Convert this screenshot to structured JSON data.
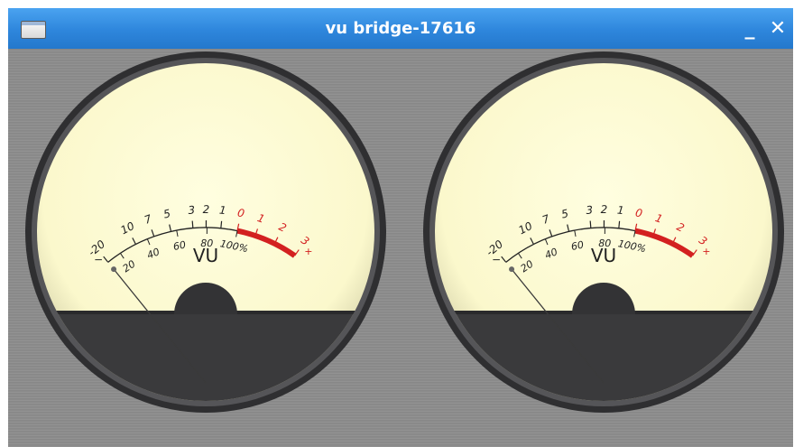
{
  "window": {
    "title": "vu bridge-17616",
    "minimize_label": "_",
    "close_label": "✕"
  },
  "meters": [
    {
      "label": "VU",
      "reading_db": -20,
      "db_scale": [
        {
          "label": "-20",
          "red": false
        },
        {
          "label": "10",
          "red": false
        },
        {
          "label": "7",
          "red": false
        },
        {
          "label": "5",
          "red": false
        },
        {
          "label": "3",
          "red": false
        },
        {
          "label": "2",
          "red": false
        },
        {
          "label": "1",
          "red": false
        },
        {
          "label": "0",
          "red": true
        },
        {
          "label": "1",
          "red": true
        },
        {
          "label": "2",
          "red": true
        },
        {
          "label": "3",
          "red": true
        }
      ],
      "percent_scale": [
        "20",
        "40",
        "60",
        "80",
        "100%"
      ],
      "plus_mark": "+",
      "minus_mark": "−"
    },
    {
      "label": "VU",
      "reading_db": -20,
      "db_scale": [
        {
          "label": "-20",
          "red": false
        },
        {
          "label": "10",
          "red": false
        },
        {
          "label": "7",
          "red": false
        },
        {
          "label": "5",
          "red": false
        },
        {
          "label": "3",
          "red": false
        },
        {
          "label": "2",
          "red": false
        },
        {
          "label": "1",
          "red": false
        },
        {
          "label": "0",
          "red": true
        },
        {
          "label": "1",
          "red": true
        },
        {
          "label": "2",
          "red": true
        },
        {
          "label": "3",
          "red": true
        }
      ],
      "percent_scale": [
        "20",
        "40",
        "60",
        "80",
        "100%"
      ],
      "plus_mark": "+",
      "minus_mark": "−"
    }
  ],
  "colors": {
    "titlebar": "#2e86dc",
    "face": "#fdfbd3",
    "bezel": "#2f2f31",
    "red_zone": "#d32020",
    "scale_ink": "#222222"
  }
}
